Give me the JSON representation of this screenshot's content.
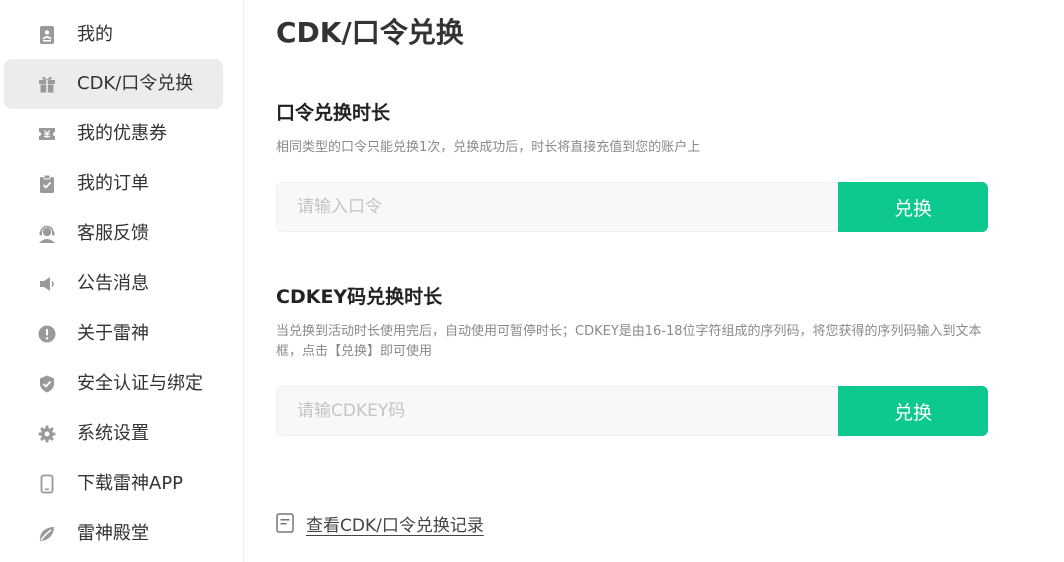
{
  "sidebar": {
    "items": [
      {
        "label": "我的",
        "icon": "user-card-icon",
        "active": false
      },
      {
        "label": "CDK/口令兑换",
        "icon": "gift-icon",
        "active": true
      },
      {
        "label": "我的优惠券",
        "icon": "coupon-icon",
        "active": false
      },
      {
        "label": "我的订单",
        "icon": "clipboard-check-icon",
        "active": false
      },
      {
        "label": "客服反馈",
        "icon": "customer-service-icon",
        "active": false
      },
      {
        "label": "公告消息",
        "icon": "speaker-icon",
        "active": false
      },
      {
        "label": "关于雷神",
        "icon": "info-exclamation-icon",
        "active": false
      },
      {
        "label": "安全认证与绑定",
        "icon": "shield-check-icon",
        "active": false
      },
      {
        "label": "系统设置",
        "icon": "gear-icon",
        "active": false
      },
      {
        "label": "下载雷神APP",
        "icon": "mobile-phone-icon",
        "active": false
      },
      {
        "label": "雷神殿堂",
        "icon": "leaf-icon",
        "active": false
      }
    ]
  },
  "main": {
    "title": "CDK/口令兑换",
    "password_section": {
      "title": "口令兑换时长",
      "description": "相同类型的口令只能兑换1次，兑换成功后，时长将直接充值到您的账户上",
      "input_placeholder": "请输入口令",
      "input_value": "",
      "button_label": "兑换"
    },
    "cdkey_section": {
      "title": "CDKEY码兑换时长",
      "description": "当兑换到活动时长使用完后，自动使用可暂停时长；CDKEY是由16-18位字符组成的序列码，将您获得的序列码输入到文本框，点击【兑换】即可使用",
      "input_placeholder": "请输CDKEY码",
      "input_value": "",
      "button_label": "兑换"
    },
    "record_link": {
      "label": "查看CDK/口令兑换记录",
      "icon": "document-list-icon"
    }
  },
  "colors": {
    "accent": "#0ec98f",
    "active_nav_bg": "#ececec",
    "icon_gray": "#9a9a9a",
    "input_bg": "#f8f8f8"
  }
}
